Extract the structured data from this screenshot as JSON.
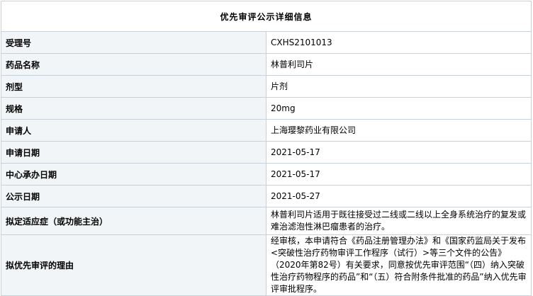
{
  "title": "优先审评公示详细信息",
  "rows": [
    {
      "label": "受理号",
      "value": "CXHS2101013"
    },
    {
      "label": "药品名称",
      "value": "林普利司片"
    },
    {
      "label": "剂型",
      "value": "片剂"
    },
    {
      "label": "规格",
      "value": "20mg"
    },
    {
      "label": "申请人",
      "value": "上海璎黎药业有限公司"
    },
    {
      "label": "申请日期",
      "value": "2021-05-17"
    },
    {
      "label": "中心承办日期",
      "value": "2021-05-17"
    },
    {
      "label": "公示日期",
      "value": "2021-05-27"
    },
    {
      "label": "拟定适应症（或功能主治）",
      "value": "林普利司片适用于既往接受过二线或二线以上全身系统治疗的复发或难治滤泡性淋巴瘤患者的治疗。"
    },
    {
      "label": "拟优先审评的理由",
      "value": "经审核，本申请符合《药品注册管理办法》和《国家药监局关于发布<突破性治疗药物审评工作程序（试行）>等三个文件的公告》（2020年第82号）有关要求，同意按优先审评范围“（四）纳入突破性治疗药物程序的药品”和“（五）符合附条件批准的药品”纳入优先审评审批程序。"
    }
  ]
}
